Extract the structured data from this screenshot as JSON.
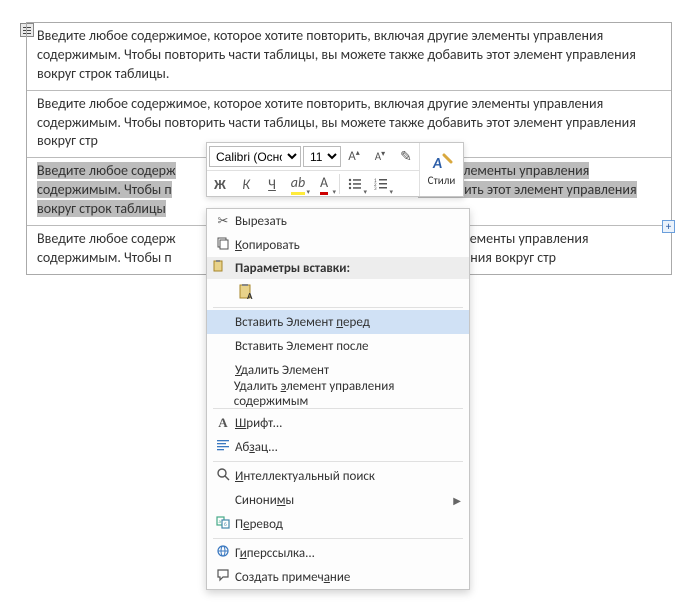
{
  "cells": {
    "c1": "Введите любое содержимое, которое хотите повторить, включая другие элементы управления содержимым. Чтобы повторить части таблицы, вы можете также добавить этот элемент управления вокруг строк таблицы.",
    "c2": "Введите любое содержимое, которое хотите повторить, включая другие элементы управления содержимым. Чтобы повторить части таблицы, вы можете также добавить этот элемент управления вокруг стр",
    "c3_pre": "Введите любое содерж",
    "c3_mid": "ая другие элементы управления содержимым. Чтобы п",
    "c3_post": "е добавить этот элемент управления вокруг строк таблицы",
    "c4_pre": "Введите любое содерж",
    "c4_mid": "ие элементы управления содержимым. Чтобы п",
    "c4_post": "авить этот элемент управления вокруг стр"
  },
  "mini_toolbar": {
    "font": "Calibri (Осно",
    "size": "11",
    "painter": "✎",
    "styles_label": "Стили",
    "bold": "Ж",
    "italic": "К",
    "underline": "Ч"
  },
  "context_menu": {
    "cut": "Вырезать",
    "copy": "Копировать",
    "paste_section": "Параметры вставки:",
    "insert_before": "Вставить Элемент перед",
    "insert_after": "Вставить Элемент после",
    "delete_element": "Удалить Элемент",
    "delete_cc": "Удалить элемент управления содержимым",
    "font": "Шрифт...",
    "paragraph": "Абзац...",
    "smart_lookup": "Интеллектуальный поиск",
    "synonyms": "Синонимы",
    "translate": "Перевод",
    "hyperlink": "Гиперссылка...",
    "comment": "Создать примечание"
  },
  "plus": "+"
}
